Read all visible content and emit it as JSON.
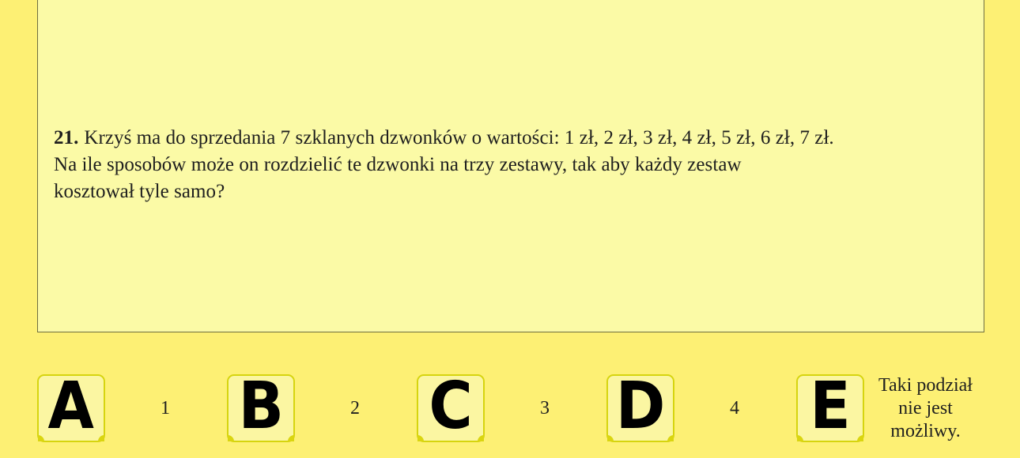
{
  "question": {
    "number": "21.",
    "lines": [
      "Krzyś ma do sprzedania 7 szklanych dzwonków o wartości: 1 zł, 2 zł, 3 zł, 4 zł, 5 zł, 6 zł, 7 zł.",
      "Na ile sposobów może on rozdzielić te dzwonki na trzy zestawy, tak aby każdy zestaw",
      "kosztował tyle samo?"
    ]
  },
  "answers": [
    {
      "letter": "A",
      "text": "1"
    },
    {
      "letter": "B",
      "text": "2"
    },
    {
      "letter": "C",
      "text": "3"
    },
    {
      "letter": "D",
      "text": "4"
    },
    {
      "letter": "E",
      "text_lines": [
        "Taki podział",
        "nie jest",
        "możliwy."
      ]
    }
  ]
}
